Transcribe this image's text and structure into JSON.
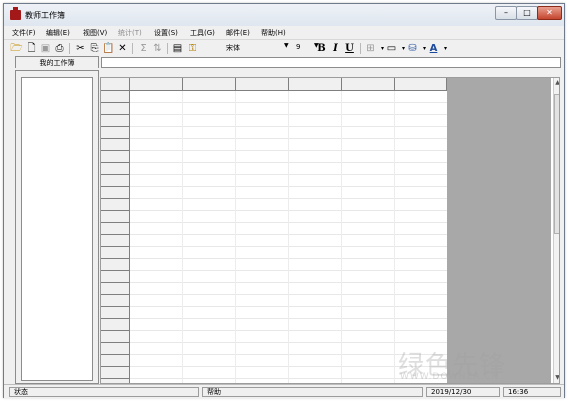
{
  "window": {
    "title": "教师工作簿"
  },
  "menu": [
    "文件(F)",
    "编辑(E)",
    "视图(V)",
    "统计(T)",
    "设置(S)",
    "工具(G)",
    "邮件(E)",
    "帮助(H)"
  ],
  "toolbar": {
    "font_name": "宋体",
    "font_size": "9",
    "bold": "B",
    "italic": "I",
    "underline": "U"
  },
  "tab": {
    "label": "我的工作簿"
  },
  "status": {
    "left": "状态",
    "help": "帮助",
    "date": "2019/12/30",
    "time": "16:36"
  },
  "watermark": {
    "text": "绿色先锋",
    "sub": "WWW.DOWNZA.CN"
  }
}
